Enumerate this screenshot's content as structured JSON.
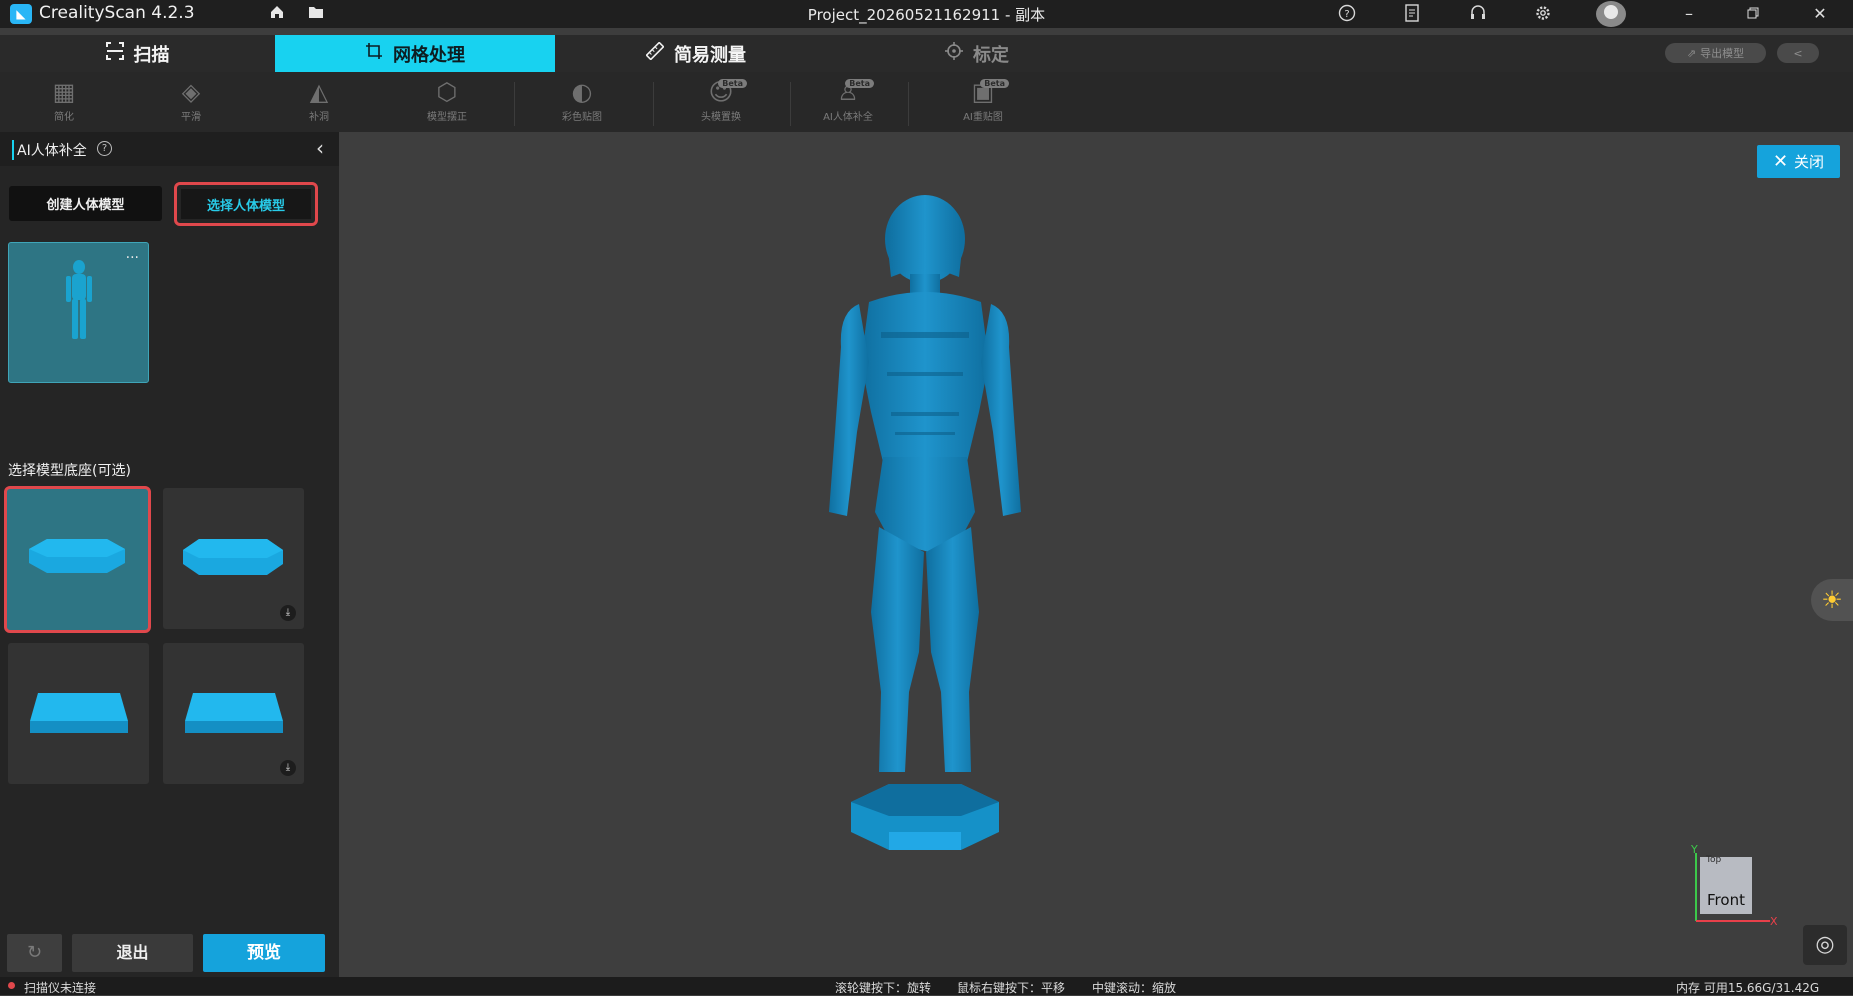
{
  "app": {
    "title": "CrealityScan 4.2.3",
    "project_title": "Project_20260521162911 - 副本"
  },
  "modes": [
    {
      "label": "扫描",
      "icon": "scan-frame-icon",
      "state": "normal"
    },
    {
      "label": "网格处理",
      "icon": "crop-frame-icon",
      "state": "active"
    },
    {
      "label": "简易测量",
      "icon": "ruler-icon",
      "state": "normal"
    },
    {
      "label": "标定",
      "icon": "crosshair-icon",
      "state": "disabled"
    }
  ],
  "header_actions": {
    "export_label": "导出模型"
  },
  "tools": [
    {
      "label": "简化",
      "beta": ""
    },
    {
      "label": "平滑",
      "beta": ""
    },
    {
      "label": "补洞",
      "beta": ""
    },
    {
      "label": "模型摆正",
      "beta": ""
    },
    {
      "label": "彩色贴图",
      "beta": ""
    },
    {
      "label": "头模置换",
      "beta": "Beta"
    },
    {
      "label": "AI人体补全",
      "beta": "Beta"
    },
    {
      "label": "AI重贴图",
      "beta": "Beta"
    }
  ],
  "panel": {
    "title": "AI人体补全",
    "create_label": "创建人体模型",
    "select_label": "选择人体模型",
    "thumb_more": "···",
    "base_label": "选择模型底座(可选)",
    "bases": [
      {
        "shape": "octagon",
        "selected": true,
        "downloadable": false
      },
      {
        "shape": "octagon",
        "selected": false,
        "downloadable": true
      },
      {
        "shape": "square",
        "selected": false,
        "downloadable": false
      },
      {
        "shape": "square",
        "selected": false,
        "downloadable": true
      }
    ],
    "exit_label": "退出",
    "preview_label": "预览"
  },
  "viewport": {
    "close_label": "关闭",
    "cube": {
      "face": "Front",
      "top": "Top",
      "axis_y": "Y",
      "axis_x": "X"
    }
  },
  "status": {
    "scanner": "扫描仪未连接",
    "hint_wheel": "滚轮键按下：旋转",
    "hint_right": "鼠标右键按下：平移",
    "hint_middle": "中键滚动：缩放",
    "memory": "内存 可用15.66G/31.42G"
  },
  "colors": {
    "accent": "#18d2f0",
    "primary_button": "#15a3dc",
    "model": "#1f8fc4",
    "highlight_border": "#e0484c"
  }
}
